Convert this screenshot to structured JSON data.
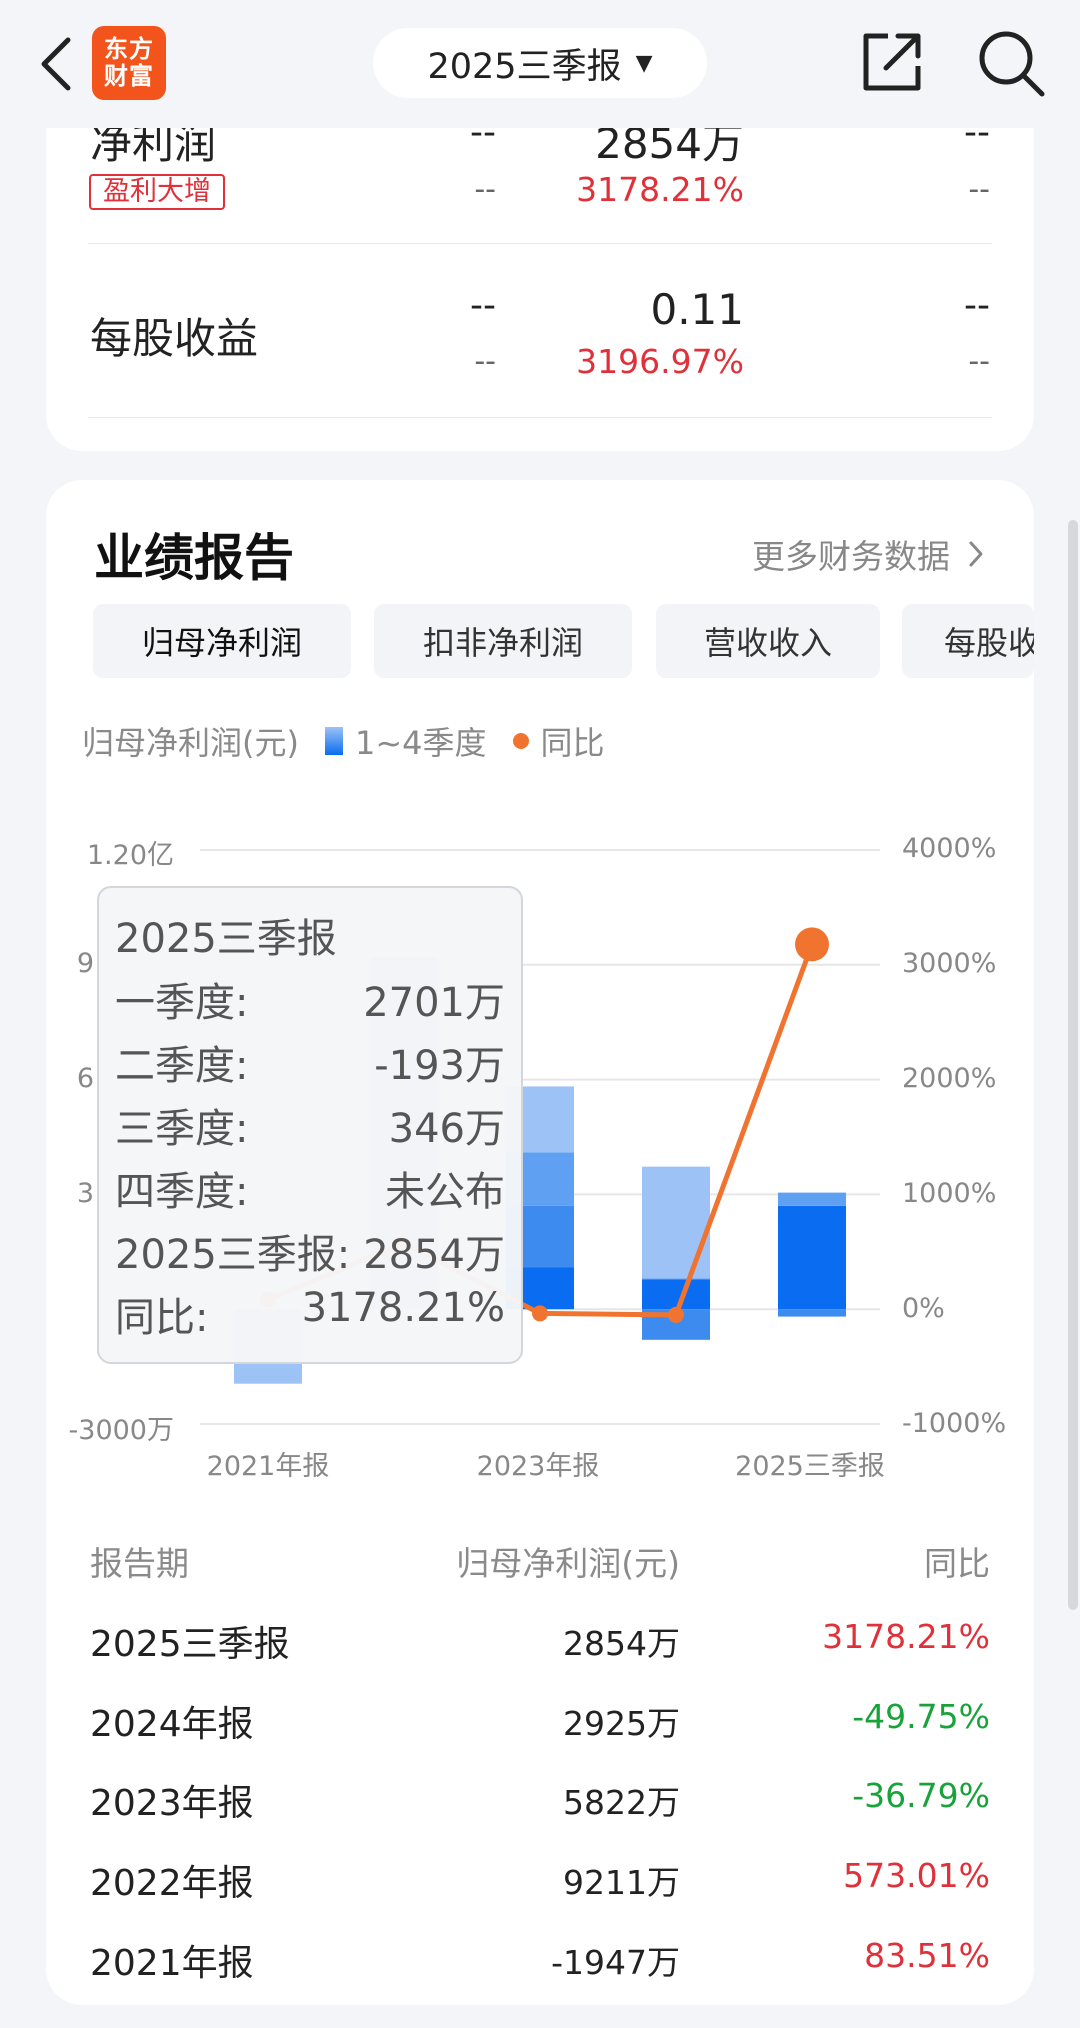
{
  "header": {
    "logo_line1": "东方",
    "logo_line2": "财富",
    "period": "2025三季报",
    "caret": "▼",
    "icons": [
      "back-icon",
      "share-icon",
      "search-icon"
    ]
  },
  "summary": {
    "rows": [
      {
        "name": "净利润",
        "tag": "盈利大增",
        "col1": "--",
        "col1_sub": "--",
        "value": "2854万",
        "value_sub": "3178.21%",
        "col3": "--",
        "col3_sub": "--"
      },
      {
        "name": "每股收益",
        "col1": "--",
        "col1_sub": "--",
        "value": "0.11",
        "value_sub": "3196.97%",
        "col3": "--",
        "col3_sub": "--"
      }
    ]
  },
  "report": {
    "title": "业绩报告",
    "more": "更多财务数据",
    "tabs": [
      "归母净利润",
      "扣非净利润",
      "营收收入",
      "每股收"
    ],
    "legend_label": "归母净利润(元)",
    "legend_bar": "1~4季度",
    "legend_line": "同比"
  },
  "chart_data": {
    "type": "bar",
    "left_axis_ticks": [
      "1.20亿",
      "9",
      "6",
      "3",
      "-3000万"
    ],
    "right_axis_ticks": [
      "4000%",
      "3000%",
      "2000%",
      "1000%",
      "0%",
      "-1000%"
    ],
    "x_labels": [
      "2021年报",
      "2023年报",
      "2025三季报"
    ],
    "ylim_left": [
      -30000000,
      120000000
    ],
    "ylim_right": [
      -1000,
      4000
    ],
    "categories": [
      "2021年报",
      "2022年报",
      "2023年报",
      "2024年报",
      "2025三季报"
    ],
    "stacked_bars": [
      {
        "category": "2021年报",
        "quarters": [
          -1947
        ]
      },
      {
        "category": "2022年报",
        "quarters": [
          9211
        ]
      },
      {
        "category": "2023年报",
        "quarters": [
          1100,
          1600,
          1400,
          1722
        ]
      },
      {
        "category": "2024年报",
        "quarters": [
          800,
          -800,
          0,
          2925
        ]
      },
      {
        "category": "2025三季报",
        "quarters": [
          2701,
          -193,
          346
        ]
      }
    ],
    "yoy_series": {
      "name": "同比",
      "values": [
        83.51,
        573.01,
        -36.79,
        -49.75,
        3178.21
      ]
    },
    "colors": {
      "q1": "#0a6cf0",
      "q2": "#3d8bef",
      "q3": "#5fa0f2",
      "q4": "#9dc2f6",
      "line": "#f07430",
      "grid": "#e6e6e9"
    }
  },
  "tooltip": {
    "title": "2025三季报",
    "rows": [
      {
        "label": "一季度:",
        "value": "2701万"
      },
      {
        "label": "二季度:",
        "value": "-193万"
      },
      {
        "label": "三季度:",
        "value": "346万"
      },
      {
        "label": "四季度:",
        "value": "未公布"
      },
      {
        "label": "2025三季报:",
        "value": "2854万"
      },
      {
        "label": "同比:",
        "value": "3178.21%"
      }
    ]
  },
  "table": {
    "headers": [
      "报告期",
      "归母净利润(元)",
      "同比"
    ],
    "rows": [
      {
        "period": "2025三季报",
        "value": "2854万",
        "yoy": "3178.21%",
        "dir": "up"
      },
      {
        "period": "2024年报",
        "value": "2925万",
        "yoy": "-49.75%",
        "dir": "down"
      },
      {
        "period": "2023年报",
        "value": "5822万",
        "yoy": "-36.79%",
        "dir": "down"
      },
      {
        "period": "2022年报",
        "value": "9211万",
        "yoy": "573.01%",
        "dir": "up"
      },
      {
        "period": "2021年报",
        "value": "-1947万",
        "yoy": "83.51%",
        "dir": "up"
      }
    ]
  }
}
